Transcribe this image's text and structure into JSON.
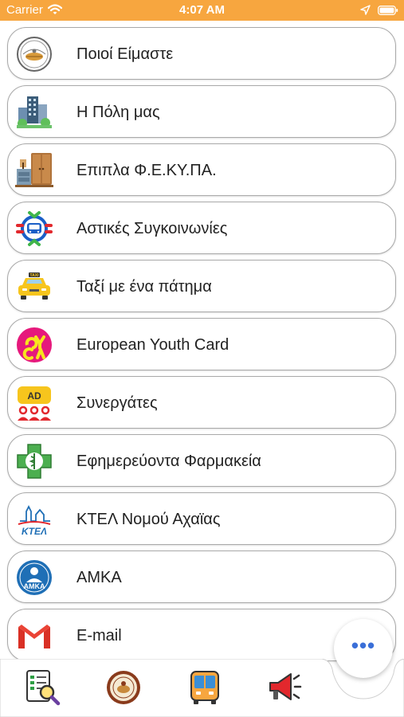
{
  "status_bar": {
    "carrier": "Carrier",
    "time": "4:07 AM"
  },
  "menu": {
    "items": [
      {
        "label": "Ποιοί Είμαστε",
        "icon": "municipality-seal-icon"
      },
      {
        "label": "Η Πόλη μας",
        "icon": "city-buildings-icon"
      },
      {
        "label": "Επιπλα Φ.Ε.ΚΥ.ΠΑ.",
        "icon": "furniture-icon"
      },
      {
        "label": "Αστικές Συγκοινωνίες",
        "icon": "bus-transport-icon"
      },
      {
        "label": "Ταξί με ένα πάτημα",
        "icon": "taxi-icon"
      },
      {
        "label": "European Youth Card",
        "icon": "youth-card-icon"
      },
      {
        "label": "Συνεργάτες",
        "icon": "partners-icon"
      },
      {
        "label": "Εφημερεύοντα Φαρμακεία",
        "icon": "pharmacy-icon"
      },
      {
        "label": "ΚΤΕΛ Νομού Αχαϊας",
        "icon": "ktel-icon"
      },
      {
        "label": "ΑΜΚΑ",
        "icon": "amka-icon"
      },
      {
        "label": "E-mail",
        "icon": "gmail-icon"
      }
    ]
  },
  "tab_bar": {
    "tabs": [
      {
        "icon": "document-search-icon"
      },
      {
        "icon": "municipality-seal-icon"
      },
      {
        "icon": "bus-icon"
      },
      {
        "icon": "megaphone-icon"
      }
    ],
    "more_label": "•••"
  },
  "colors": {
    "status_bar": "#f7a63f",
    "item_border": "#a9a9a9",
    "fab_dots": "#3a6fd8"
  }
}
